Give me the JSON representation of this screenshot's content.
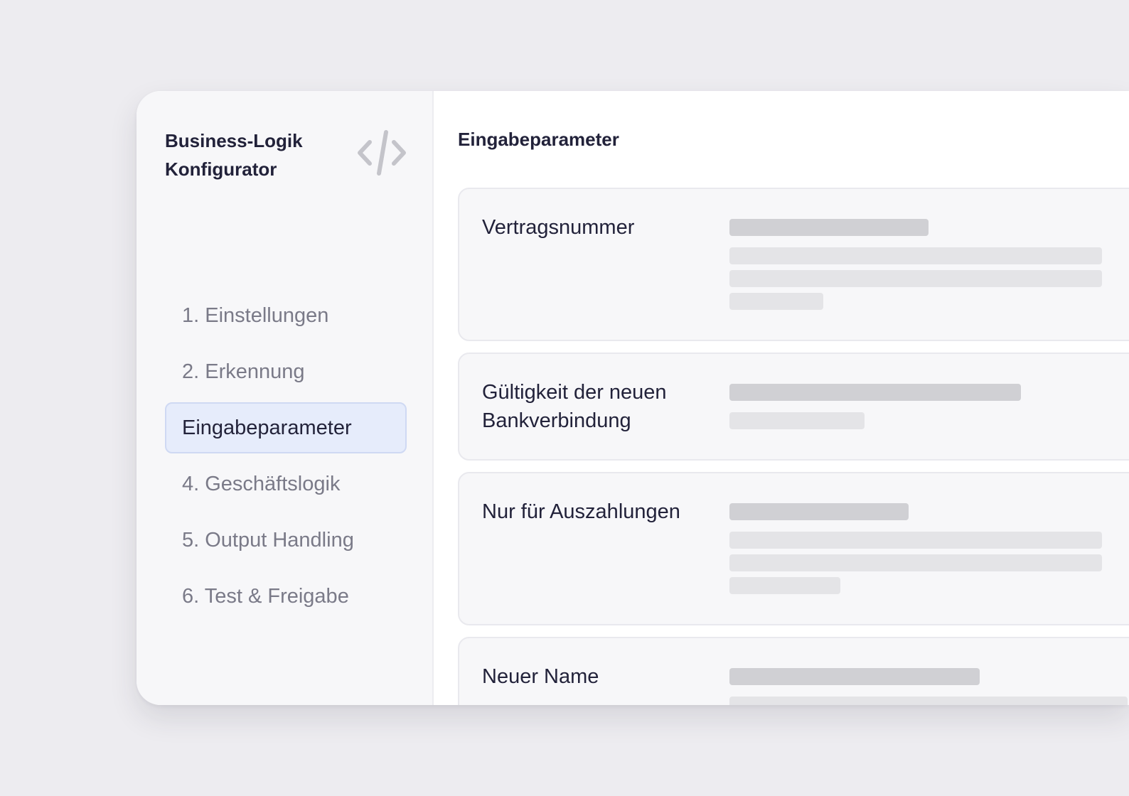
{
  "sidebar": {
    "title_line1": "Business-Logik",
    "title_line2": "Konfigurator",
    "title_icon": "code-icon",
    "items": [
      {
        "label": "1. Einstellungen",
        "active": false
      },
      {
        "label": "2. Erkennung",
        "active": false
      },
      {
        "label": "Eingabeparameter",
        "active": true
      },
      {
        "label": "4. Geschäftslogik",
        "active": false
      },
      {
        "label": "5. Output Handling",
        "active": false
      },
      {
        "label": "6. Test & Freigabe",
        "active": false
      }
    ]
  },
  "main": {
    "title": "Eingabeparameter",
    "parameters": [
      {
        "label_line1": "Vertragsnummer",
        "label_line2": ""
      },
      {
        "label_line1": "Gültigkeit der neuen",
        "label_line2": "Bankverbindung"
      },
      {
        "label_line1": "Nur für Auszahlungen",
        "label_line2": ""
      },
      {
        "label_line1": "Neuer Name",
        "label_line2": ""
      }
    ]
  },
  "colors": {
    "background": "#edecf0",
    "sidebar_bg": "#f7f7f9",
    "active_item_bg": "#e6ecfb",
    "active_item_border": "#cfd9f3",
    "text_primary": "#22223a",
    "text_muted": "#7a7a88",
    "skeleton_dark": "#d0d0d4",
    "skeleton_light": "#e4e4e7"
  }
}
